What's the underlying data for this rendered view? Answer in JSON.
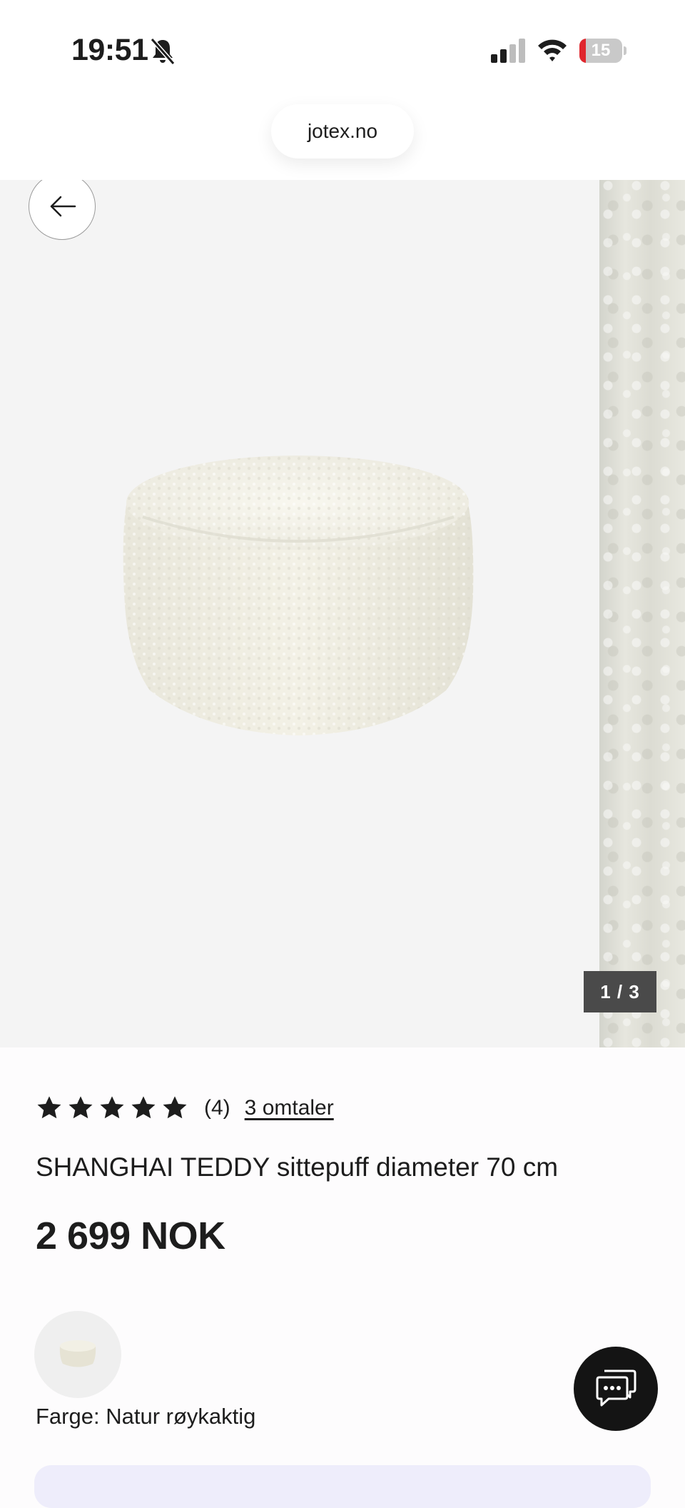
{
  "status_bar": {
    "time": "19:51",
    "battery_level": "15",
    "battery_fraction": 0.15,
    "icons": [
      "bell-slash-icon",
      "cellular-signal-icon",
      "wifi-icon",
      "battery-icon"
    ]
  },
  "browser": {
    "url": "jotex.no"
  },
  "gallery": {
    "counter": "1 / 3",
    "back_icon": "arrow-left-icon"
  },
  "product": {
    "rating_stars": 5,
    "rating_count": "(4)",
    "reviews_link": "3 omtaler",
    "title": "SHANGHAI TEDDY sittepuff diameter 70 cm",
    "price": "2 699 NOK",
    "color_label": "Farge: Natur røykaktig"
  },
  "chat": {
    "icon": "chat-bubbles-icon"
  },
  "colors": {
    "star": "#1d1d1d",
    "battery_low": "#e0262d",
    "chat_bg": "#141414",
    "bottom_panel": "#eeedfb"
  }
}
